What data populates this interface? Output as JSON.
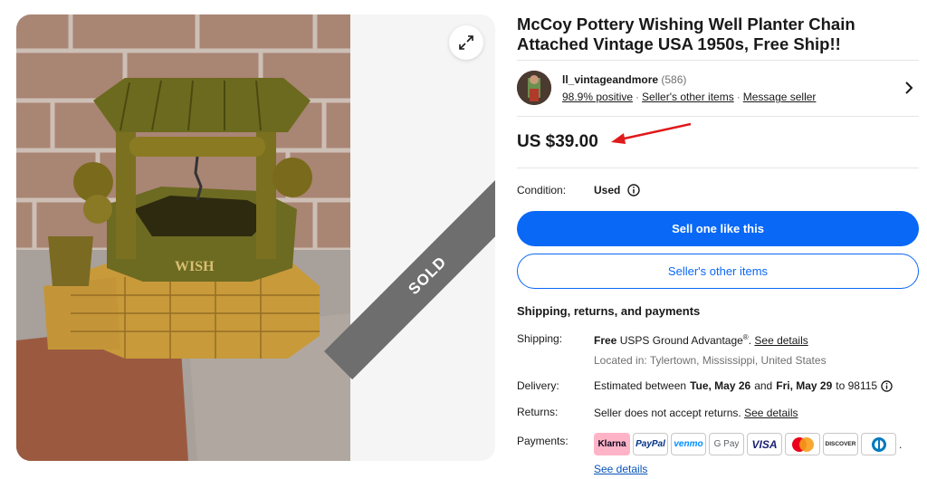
{
  "listing": {
    "title": "McCoy Pottery Wishing Well Planter Chain Attached Vintage USA 1950s, Free Ship!!",
    "sold_ribbon": "SOLD"
  },
  "seller": {
    "name": "ll_vintageandmore",
    "count": "(586)",
    "positive": "98.9% positive",
    "other_items": "Seller's other items",
    "message": "Message seller"
  },
  "price": "US $39.00",
  "condition": {
    "label": "Condition:",
    "value": "Used"
  },
  "buttons": {
    "sell": "Sell one like this",
    "other_items": "Seller's other items"
  },
  "shipping": {
    "section_title": "Shipping, returns, and payments",
    "shipping_label": "Shipping:",
    "shipping_free": "Free",
    "shipping_service": "USPS Ground Advantage",
    "shipping_reg": "®",
    "shipping_dot": ".",
    "see_details": "See details",
    "location": "Located in: Tylertown, Mississippi, United States",
    "delivery_label": "Delivery:",
    "delivery_pre": "Estimated between",
    "delivery_start": "Tue, May 26",
    "delivery_and": "and",
    "delivery_end": "Fri, May 29",
    "delivery_to": "to 98115",
    "returns_label": "Returns:",
    "returns_text": "Seller does not accept returns.",
    "payments_label": "Payments:",
    "payments_see_details": "See details"
  },
  "payments": [
    {
      "name": "Klarna",
      "color": "#ffb3c7",
      "text_color": "#0b051d"
    },
    {
      "name": "PayPal",
      "color": "#ffffff",
      "text_color": "#003087"
    },
    {
      "name": "venmo",
      "color": "#ffffff",
      "text_color": "#008cff"
    },
    {
      "name": "G Pay",
      "color": "#ffffff",
      "text_color": "#5f6368"
    },
    {
      "name": "VISA",
      "color": "#ffffff",
      "text_color": "#1a1f71"
    },
    {
      "name": "Mastercard",
      "color": "#ffffff",
      "text_color": "#eb001b"
    },
    {
      "name": "DISCOVER",
      "color": "#ffffff",
      "text_color": "#231f20"
    },
    {
      "name": "Diners Club",
      "color": "#ffffff",
      "text_color": "#0079be"
    }
  ],
  "colors": {
    "primary": "#0968f6",
    "link": "#0654ba",
    "annotation_arrow": "#e0191b"
  }
}
